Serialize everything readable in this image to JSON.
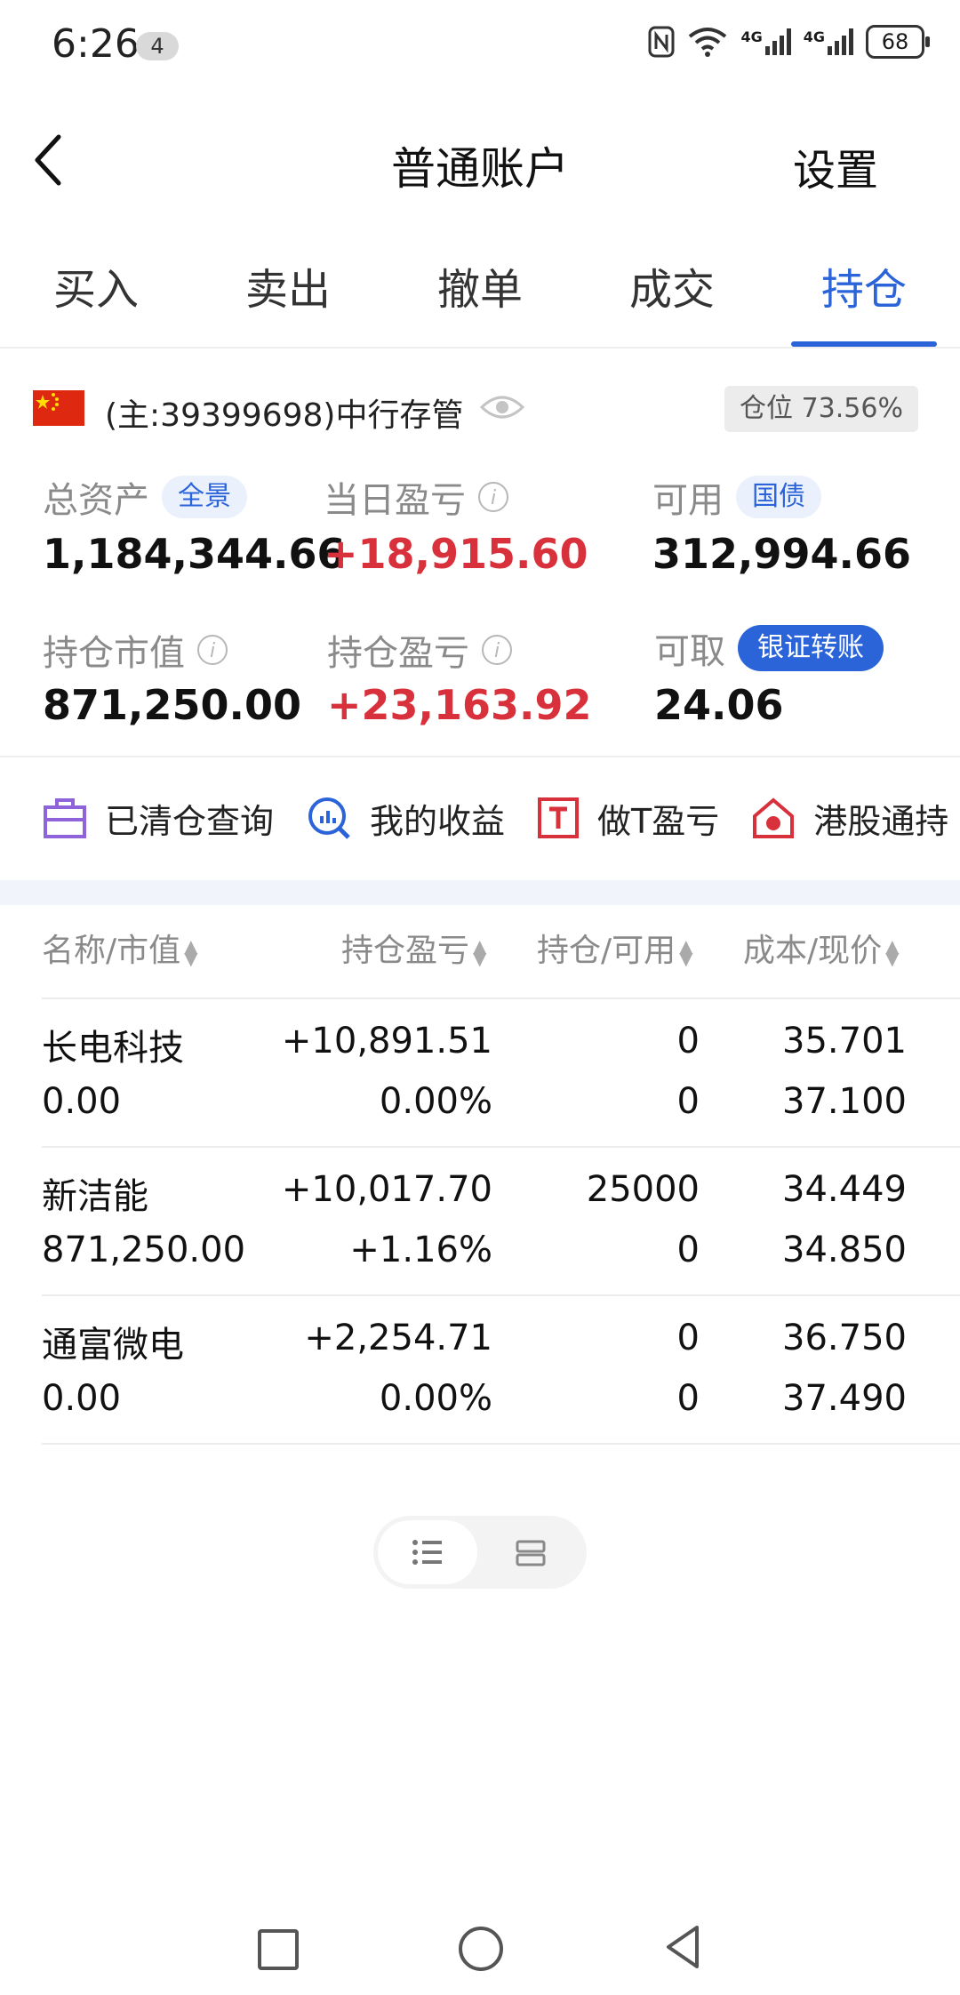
{
  "status_bar": {
    "time": "6:26",
    "badge": "4",
    "signal1": "4G",
    "signal2": "4G",
    "battery": "68"
  },
  "header": {
    "title": "普通账户",
    "settings": "设置"
  },
  "tabs": [
    {
      "label": "买入",
      "active": false
    },
    {
      "label": "卖出",
      "active": false
    },
    {
      "label": "撤单",
      "active": false
    },
    {
      "label": "成交",
      "active": false
    },
    {
      "label": "持仓",
      "active": true
    }
  ],
  "account": {
    "label": "(主:39399698)中行存管",
    "position_ratio": "仓位 73.56%"
  },
  "stats": {
    "total_assets": {
      "label": "总资产",
      "value": "1,184,344.66",
      "tag": "全景"
    },
    "daily_pnl": {
      "label": "当日盈亏",
      "value": "+18,915.60"
    },
    "available": {
      "label": "可用",
      "value": "312,994.66",
      "tag": "国债"
    },
    "market_value": {
      "label": "持仓市值",
      "value": "871,250.00"
    },
    "holding_pnl": {
      "label": "持仓盈亏",
      "value": "+23,163.92"
    },
    "withdrawable": {
      "label": "可取",
      "value": "24.06",
      "tag": "银证转账"
    }
  },
  "quick_links": [
    {
      "label": "已清仓查询",
      "icon": "briefcase-icon"
    },
    {
      "label": "我的收益",
      "icon": "chart-search-icon"
    },
    {
      "label": "做T盈亏",
      "icon": "t-box-icon"
    },
    {
      "label": "港股通持",
      "icon": "hk-flower-icon"
    }
  ],
  "table": {
    "headers": [
      "名称/市值",
      "持仓盈亏",
      "持仓/可用",
      "成本/现价"
    ],
    "rows": [
      {
        "name": "长电科技",
        "market_value": "0.00",
        "pnl": "+10,891.51",
        "pnl_pct": "0.00%",
        "hold": "0",
        "avail": "0",
        "cost": "35.701",
        "price": "37.100",
        "pct_red": false
      },
      {
        "name": "新洁能",
        "market_value": "871,250.00",
        "pnl": "+10,017.70",
        "pnl_pct": "+1.16%",
        "hold": "25000",
        "avail": "0",
        "cost": "34.449",
        "price": "34.850",
        "pct_red": true
      },
      {
        "name": "通富微电",
        "market_value": "0.00",
        "pnl": "+2,254.71",
        "pnl_pct": "0.00%",
        "hold": "0",
        "avail": "0",
        "cost": "36.750",
        "price": "37.490",
        "pct_red": false
      }
    ]
  },
  "colors": {
    "accent": "#2b63d9",
    "profit": "#d9313b",
    "label_gray": "#8a8a8a"
  }
}
